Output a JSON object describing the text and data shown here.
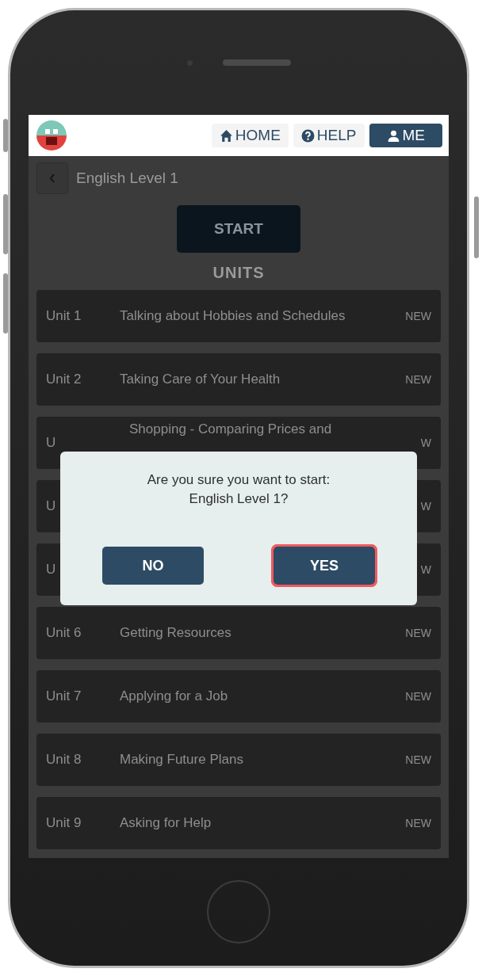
{
  "header": {
    "nav": [
      {
        "label": "HOME",
        "selected": false
      },
      {
        "label": "HELP",
        "selected": false
      },
      {
        "label": "ME",
        "selected": true
      }
    ]
  },
  "page": {
    "title": "English Level 1",
    "start_button": "START",
    "section_title": "UNITS"
  },
  "units": [
    {
      "label": "Unit 1",
      "title": "Talking about Hobbies and Schedules",
      "badge": "NEW"
    },
    {
      "label": "Unit 2",
      "title": "Taking Care of Your Health",
      "badge": "NEW"
    },
    {
      "label": "U",
      "title": "Shopping - Comparing Prices and",
      "badge": "W"
    },
    {
      "label": "U",
      "badge": "W"
    },
    {
      "label": "U",
      "badge": "W"
    },
    {
      "label": "Unit 6",
      "title": "Getting Resources",
      "badge": "NEW"
    },
    {
      "label": "Unit 7",
      "title": "Applying for a Job",
      "badge": "NEW"
    },
    {
      "label": "Unit 8",
      "title": "Making Future Plans",
      "badge": "NEW"
    },
    {
      "label": "Unit 9",
      "title": "Asking for Help",
      "badge": "NEW"
    }
  ],
  "dialog": {
    "message": "Are you sure you want to start: English Level 1?",
    "buttons": [
      {
        "label": "NO",
        "highlighted": false
      },
      {
        "label": "YES",
        "highlighted": true
      }
    ]
  }
}
